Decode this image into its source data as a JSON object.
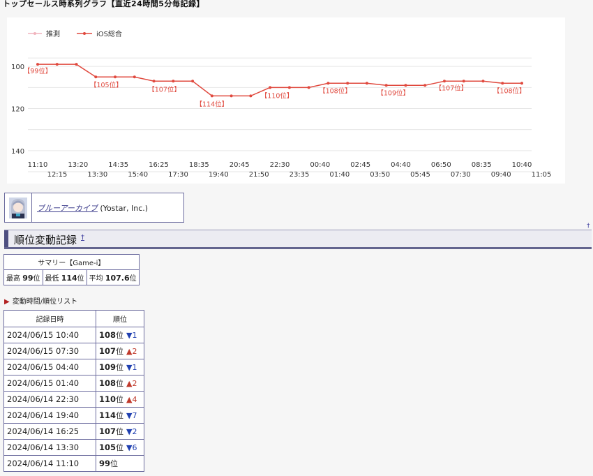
{
  "page": {
    "title": "トップセールス時系列グラフ【直近24時間5分毎記録】",
    "top_anchor": "†"
  },
  "chart_data": {
    "type": "line",
    "legend": [
      "推測",
      "iOS総合"
    ],
    "legend_position": "top-left",
    "grid": true,
    "y_reversed": true,
    "ylim": [
      91,
      150
    ],
    "yticks": [
      "100",
      "120",
      "140"
    ],
    "xticks_top": [
      "11:10",
      "13:20",
      "14:35",
      "16:25",
      "18:35",
      "20:45",
      "22:30",
      "00:40",
      "02:45",
      "04:40",
      "06:50",
      "08:35",
      "10:40"
    ],
    "xticks_bottom": [
      "12:15",
      "13:30",
      "15:40",
      "17:30",
      "19:40",
      "21:50",
      "23:35",
      "01:40",
      "03:50",
      "05:45",
      "07:30",
      "09:40",
      "11:05"
    ],
    "series": [
      {
        "name": "iOS総合",
        "color": "#e0493e",
        "values": [
          99,
          99,
          99,
          105,
          105,
          105,
          107,
          107,
          107,
          114,
          114,
          114,
          110,
          110,
          110,
          108,
          108,
          108,
          109,
          109,
          109,
          107,
          107,
          107,
          108,
          108
        ]
      },
      {
        "name": "推測",
        "color": "#f1b4bd",
        "values": []
      }
    ],
    "annotations": [
      "【99位】",
      "【105位】",
      "【107位】",
      "【114位】",
      "【110位】",
      "【108位】",
      "【109位】",
      "【107位】",
      "【108位】"
    ]
  },
  "app": {
    "name": "ブルーアーカイブ",
    "publisher": " (Yostar, Inc.)"
  },
  "section": {
    "title": "順位変動記録",
    "anchor": "†"
  },
  "summary": {
    "caption": "サマリー【Game-i】",
    "best_label": "最高",
    "best_value": "99",
    "worst_label": "最低",
    "worst_value": "114",
    "avg_label": "平均",
    "avg_value": "107.6",
    "unit": "位"
  },
  "list_toggle": "変動時間/順位リスト",
  "records": {
    "headers": [
      "記録日時",
      "順位"
    ],
    "rows": [
      {
        "datetime": "2024/06/15 10:40",
        "rank": "108",
        "unit": "位",
        "change": "▼1",
        "dir": "down"
      },
      {
        "datetime": "2024/06/15 07:30",
        "rank": "107",
        "unit": "位",
        "change": "▲2",
        "dir": "up"
      },
      {
        "datetime": "2024/06/15 04:40",
        "rank": "109",
        "unit": "位",
        "change": "▼1",
        "dir": "down"
      },
      {
        "datetime": "2024/06/15 01:40",
        "rank": "108",
        "unit": "位",
        "change": "▲2",
        "dir": "up"
      },
      {
        "datetime": "2024/06/14 22:30",
        "rank": "110",
        "unit": "位",
        "change": "▲4",
        "dir": "up"
      },
      {
        "datetime": "2024/06/14 19:40",
        "rank": "114",
        "unit": "位",
        "change": "▼7",
        "dir": "down"
      },
      {
        "datetime": "2024/06/14 16:25",
        "rank": "107",
        "unit": "位",
        "change": "▼2",
        "dir": "down"
      },
      {
        "datetime": "2024/06/14 13:30",
        "rank": "105",
        "unit": "位",
        "change": "▼6",
        "dir": "down"
      },
      {
        "datetime": "2024/06/14 11:10",
        "rank": "99",
        "unit": "位",
        "change": "",
        "dir": ""
      }
    ]
  }
}
